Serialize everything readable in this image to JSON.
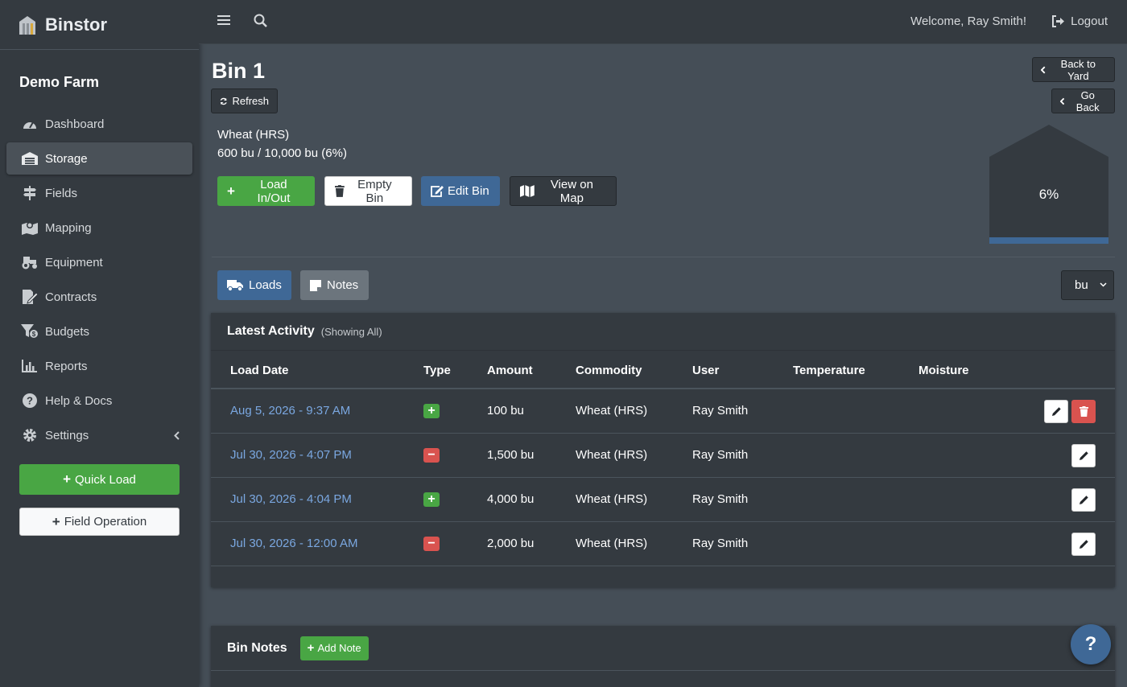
{
  "brand": {
    "name": "Binstor",
    "icon": "silo-icon"
  },
  "sidebar": {
    "farm_name": "Demo Farm",
    "items": [
      {
        "label": "Dashboard",
        "icon": "dashboard-gauge-icon"
      },
      {
        "label": "Storage",
        "icon": "warehouse-icon",
        "active": true
      },
      {
        "label": "Fields",
        "icon": "signpost-icon"
      },
      {
        "label": "Mapping",
        "icon": "map-marker-icon"
      },
      {
        "label": "Equipment",
        "icon": "tractor-icon"
      },
      {
        "label": "Contracts",
        "icon": "file-signature-icon"
      },
      {
        "label": "Budgets",
        "icon": "funnel-dollar-icon"
      },
      {
        "label": "Reports",
        "icon": "bar-chart-icon"
      },
      {
        "label": "Help & Docs",
        "icon": "question-circle-icon"
      },
      {
        "label": "Settings",
        "icon": "gear-icon"
      }
    ],
    "quick_load_label": "Quick Load",
    "field_operation_label": "Field Operation"
  },
  "topbar": {
    "welcome": "Welcome, Ray Smith!",
    "logout_label": "Logout"
  },
  "bin": {
    "title": "Bin 1",
    "refresh_label": "Refresh",
    "back_to_yard_label": "Back to Yard",
    "go_back_label": "Go Back",
    "commodity": "Wheat (HRS)",
    "amount_line": "600 bu / 10,000 bu (6%)",
    "fill_percent": 6,
    "fill_label": "6%",
    "actions": {
      "load_in_out": "Load In/Out",
      "empty_bin": "Empty Bin",
      "edit_bin": "Edit Bin",
      "view_on_map": "View on Map"
    }
  },
  "tabs": {
    "loads": "Loads",
    "notes": "Notes"
  },
  "unit_select": {
    "value": "bu"
  },
  "activity": {
    "title": "Latest Activity",
    "subtitle": "(Showing All)",
    "columns": [
      "Load Date",
      "Type",
      "Amount",
      "Commodity",
      "User",
      "Temperature",
      "Moisture"
    ],
    "rows": [
      {
        "date": "Aug 5, 2026 - 9:37 AM",
        "type": "in",
        "type_symbol": "+",
        "amount": "100 bu",
        "commodity": "Wheat (HRS)",
        "user": "Ray Smith",
        "temperature": "",
        "moisture": ""
      },
      {
        "date": "Jul 30, 2026 - 4:07 PM",
        "type": "out",
        "type_symbol": "−",
        "amount": "1,500 bu",
        "commodity": "Wheat (HRS)",
        "user": "Ray Smith",
        "temperature": "",
        "moisture": ""
      },
      {
        "date": "Jul 30, 2026 - 4:04 PM",
        "type": "in",
        "type_symbol": "+",
        "amount": "4,000 bu",
        "commodity": "Wheat (HRS)",
        "user": "Ray Smith",
        "temperature": "",
        "moisture": ""
      },
      {
        "date": "Jul 30, 2026 - 12:00 AM",
        "type": "out",
        "type_symbol": "−",
        "amount": "2,000 bu",
        "commodity": "Wheat (HRS)",
        "user": "Ray Smith",
        "temperature": "",
        "moisture": ""
      }
    ]
  },
  "notes": {
    "title": "Bin Notes",
    "add_label": "Add Note"
  },
  "help_fab": {
    "label": "?"
  },
  "colors": {
    "accent_blue": "#3f6896",
    "success_green": "#49a644",
    "danger_red": "#d9534f",
    "link_blue": "#7aa7e0"
  }
}
